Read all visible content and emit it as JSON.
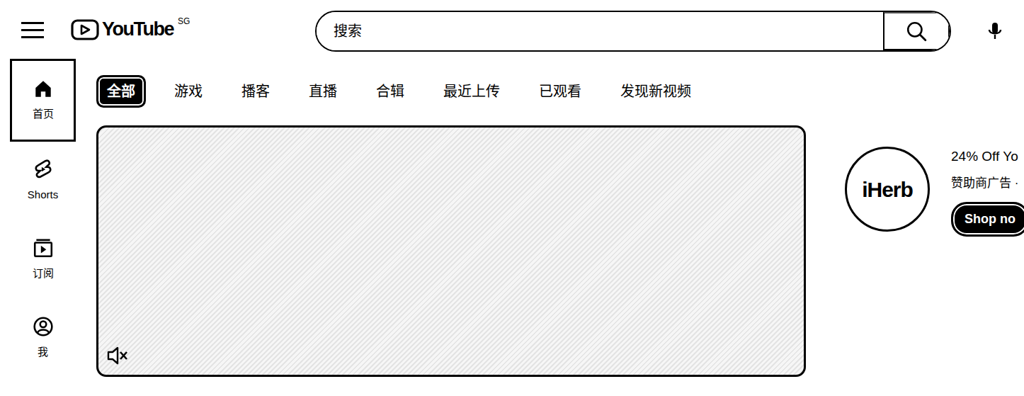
{
  "header": {
    "logo": {
      "text": "YouTube",
      "region": "SG"
    },
    "search": {
      "placeholder": "搜索"
    }
  },
  "sidebar": {
    "items": [
      {
        "label": "首页",
        "selected": true,
        "icon": "home"
      },
      {
        "label": "Shorts",
        "selected": false,
        "icon": "shorts"
      },
      {
        "label": "订阅",
        "selected": false,
        "icon": "subs"
      },
      {
        "label": "我",
        "selected": false,
        "icon": "you"
      }
    ]
  },
  "chips": [
    {
      "label": "全部",
      "selected": true
    },
    {
      "label": "游戏",
      "selected": false
    },
    {
      "label": "播客",
      "selected": false
    },
    {
      "label": "直播",
      "selected": false
    },
    {
      "label": "合辑",
      "selected": false
    },
    {
      "label": "最近上传",
      "selected": false
    },
    {
      "label": "已观看",
      "selected": false
    },
    {
      "label": "发现新视频",
      "selected": false
    }
  ],
  "video": {
    "muted": true
  },
  "ad": {
    "logo": "iHerb",
    "title": "24% Off Yo",
    "subtitle": "赞助商广告 ·",
    "button": "Shop no"
  }
}
